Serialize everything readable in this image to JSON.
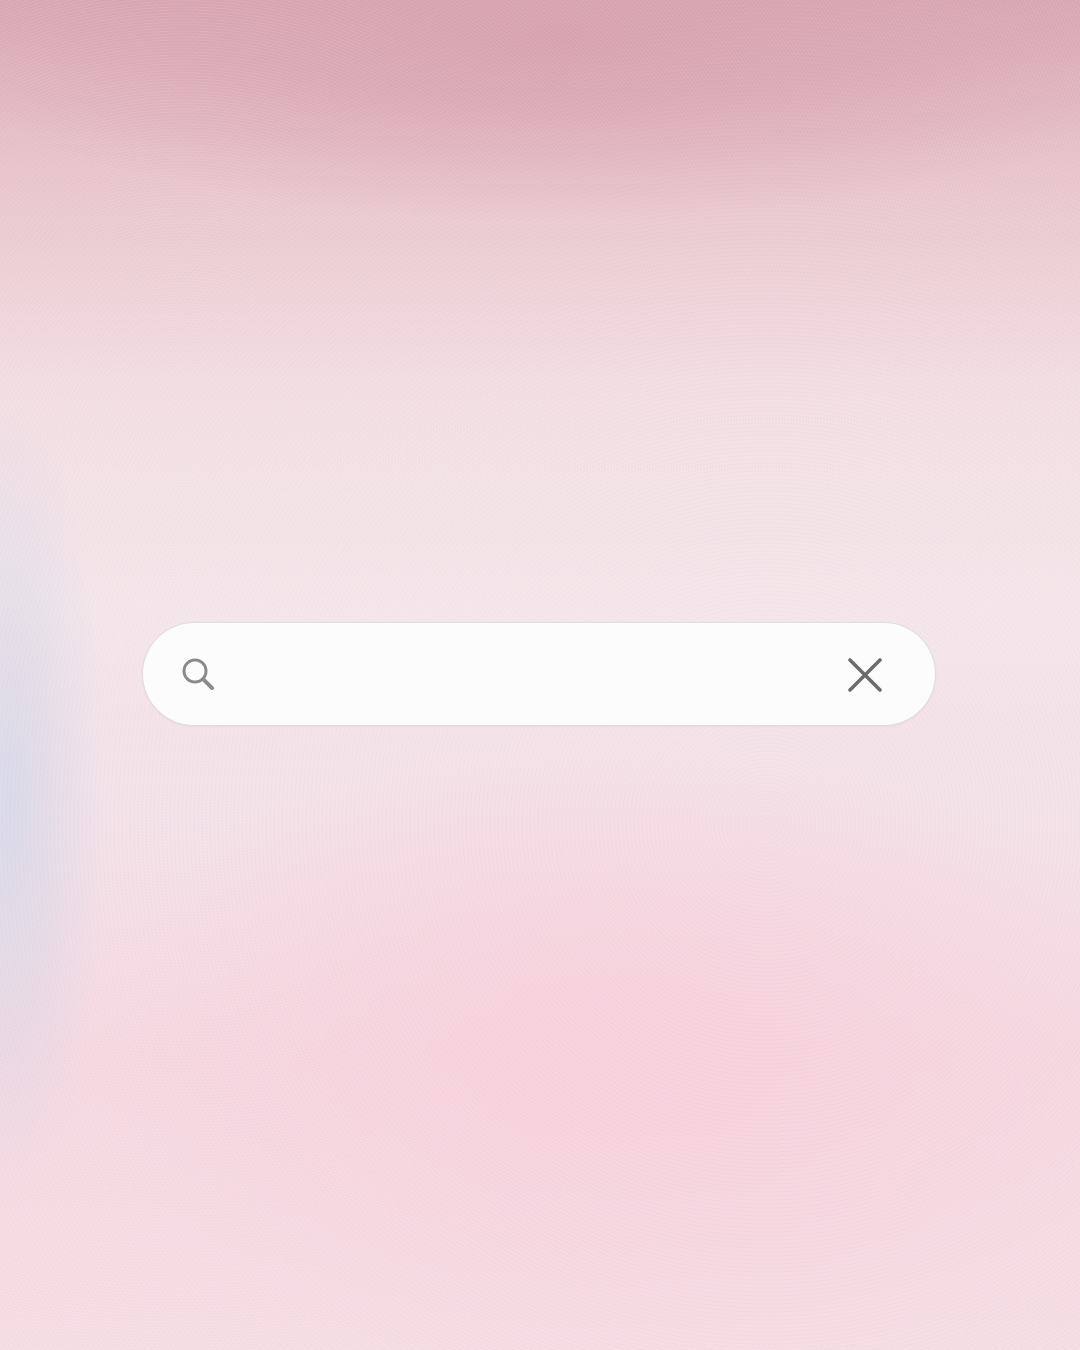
{
  "search": {
    "value": "",
    "placeholder": "",
    "icon": "search-icon",
    "clear_icon": "close-icon"
  },
  "colors": {
    "search_background": "#fcfcfc",
    "search_border": "#dedede",
    "icon_color": "#8a8a8a",
    "clear_icon_color": "#6b6b6b"
  }
}
